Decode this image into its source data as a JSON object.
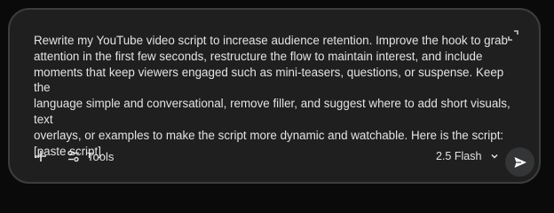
{
  "prompt": {
    "text": "Rewrite my YouTube video script to increase audience retention. Improve the hook to grab\nattention in the first few seconds, restructure the flow to maintain interest, and include\nmoments that keep viewers engaged such as mini-teasers, questions, or suspense. Keep the\nlanguage simple and conversational, remove filler, and suggest where to add short visuals, text\noverlays, or examples to make the script more dynamic and watchable. Here is the script:\n[paste script]."
  },
  "toolbar": {
    "add_icon": "plus-icon",
    "tools_icon": "sliders-icon",
    "tools_label": "Tools",
    "model_label": "2.5 Flash",
    "model_chevron_icon": "chevron-down-icon",
    "send_icon": "send-icon",
    "expand_icon": "expand-icon"
  },
  "colors": {
    "page_background": "#0a0a0a",
    "card_background": "#1f1f1f",
    "card_border": "#3d3d3d",
    "text": "#e3e3e3",
    "send_button_background": "#333537"
  }
}
